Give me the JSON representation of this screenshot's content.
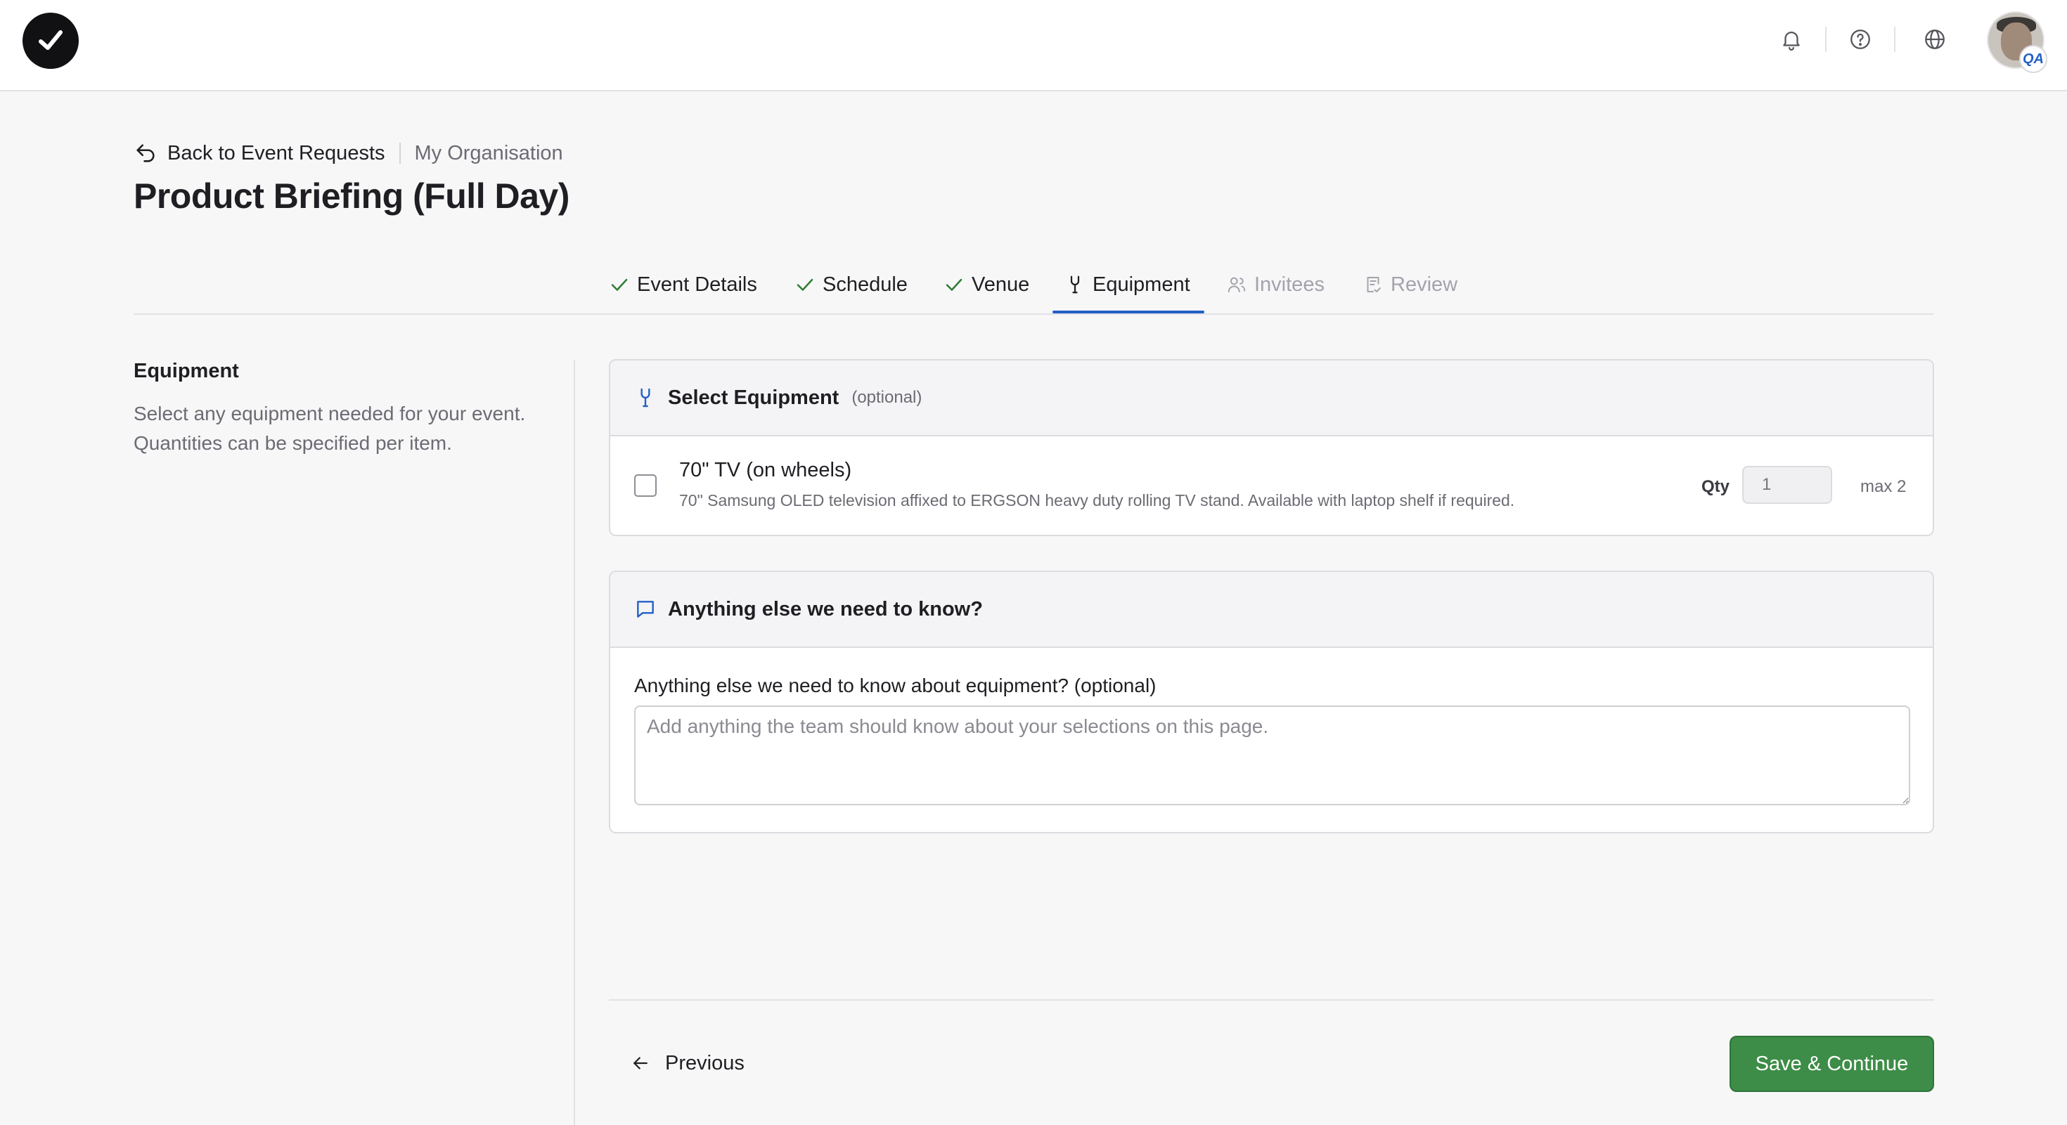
{
  "header": {
    "icons": [
      "logo-check-icon",
      "bell-icon",
      "help-icon",
      "globe-icon"
    ],
    "avatar_badge": "QA"
  },
  "breadcrumb": {
    "back_label": "Back to Event Requests",
    "org": "My Organisation"
  },
  "page": {
    "title": "Product Briefing (Full Day)"
  },
  "tabs": [
    {
      "label": "Event Details",
      "state": "done"
    },
    {
      "label": "Schedule",
      "state": "done"
    },
    {
      "label": "Venue",
      "state": "done"
    },
    {
      "label": "Equipment",
      "state": "active"
    },
    {
      "label": "Invitees",
      "state": "future"
    },
    {
      "label": "Review",
      "state": "future"
    }
  ],
  "sidebar": {
    "title": "Equipment",
    "description": "Select any equipment needed for your event. Quantities can be specified per item."
  },
  "equipment_card": {
    "title": "Select Equipment",
    "optional": "(optional)",
    "items": [
      {
        "name": "70\" TV (on wheels)",
        "description": "70\" Samsung OLED television affixed to ERGSON heavy duty rolling TV stand. Available with laptop shelf if required.",
        "qty_label": "Qty",
        "qty_placeholder": "1",
        "max": "max 2",
        "checked": false
      }
    ]
  },
  "notes_card": {
    "title": "Anything else we need to know?",
    "field_label": "Anything else we need to know about equipment? (optional)",
    "placeholder": "Add anything the team should know about your selections on this page."
  },
  "footer": {
    "previous_label": "Previous",
    "save_label": "Save & Continue"
  },
  "colors": {
    "accent": "#2360c6",
    "success": "#3d8c47",
    "check": "#2e7d32"
  }
}
